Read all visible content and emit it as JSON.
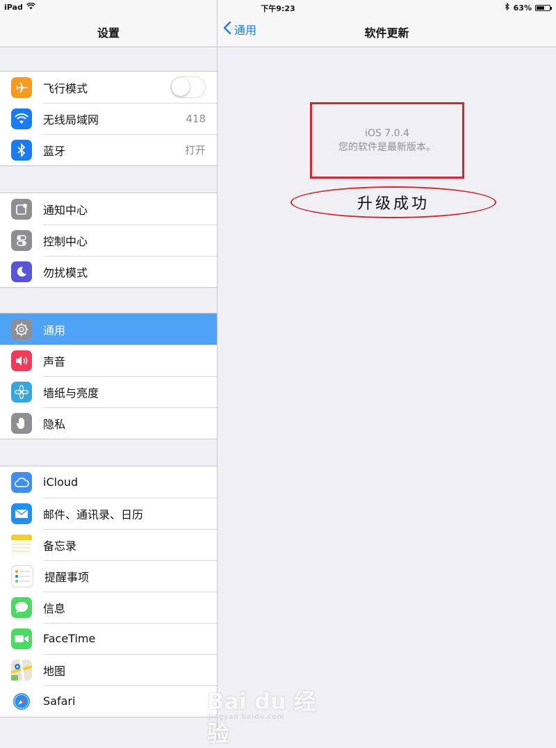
{
  "status_bar": {
    "device": "iPad",
    "time": "下午9:23",
    "battery": "63%",
    "battery_level": 0.63
  },
  "master": {
    "title": "设置",
    "groups": [
      {
        "rows": [
          {
            "label": "飞行模式",
            "icon": "airplane-icon",
            "color": "#f79a1d",
            "toggle": false
          },
          {
            "label": "无线局域网",
            "icon": "wifi-icon",
            "color": "#1a7cf5",
            "value": "418"
          },
          {
            "label": "蓝牙",
            "icon": "bluetooth-icon",
            "color": "#1a7cf5",
            "value": "打开"
          }
        ]
      },
      {
        "rows": [
          {
            "label": "通知中心",
            "icon": "notification-center-icon",
            "color": "#8e8e93"
          },
          {
            "label": "控制中心",
            "icon": "control-center-icon",
            "color": "#8e8e93"
          },
          {
            "label": "勿扰模式",
            "icon": "moon-icon",
            "color": "#5856d6"
          }
        ]
      },
      {
        "rows": [
          {
            "label": "通用",
            "icon": "gear-icon",
            "color": "#8e8e93",
            "selected": true
          },
          {
            "label": "声音",
            "icon": "speaker-icon",
            "color": "#f23b5b"
          },
          {
            "label": "墙纸与亮度",
            "icon": "flower-icon",
            "color": "#35a6de"
          },
          {
            "label": "隐私",
            "icon": "hand-icon",
            "color": "#8e8e93"
          }
        ]
      },
      {
        "rows": [
          {
            "label": "iCloud",
            "icon": "cloud-icon",
            "color": "#3e8ff0"
          },
          {
            "label": "邮件、通讯录、日历",
            "icon": "mail-icon",
            "color": "#1f8ff0"
          },
          {
            "label": "备忘录",
            "icon": "notes-icon",
            "color": "#f5cd28"
          },
          {
            "label": "提醒事项",
            "icon": "reminders-icon",
            "color": "#ffffff"
          },
          {
            "label": "信息",
            "icon": "messages-icon",
            "color": "#4cd964"
          },
          {
            "label": "FaceTime",
            "icon": "facetime-icon",
            "color": "#4cd964"
          },
          {
            "label": "地图",
            "icon": "maps-icon",
            "color": "#e9e4d7"
          },
          {
            "label": "Safari",
            "icon": "safari-icon",
            "color": "#ffffff"
          }
        ]
      }
    ]
  },
  "detail": {
    "back_label": "通用",
    "title": "软件更新",
    "ios_version": "iOS 7.0.4",
    "status_message": "您的软件是最新版本。",
    "annotation": "升级成功"
  },
  "watermark": {
    "brand": "Bai du 经验",
    "url": "jingyan.baidu.com"
  },
  "colors": {
    "accent": "#1a7cf5",
    "selected_row": "#4fa3f7",
    "annotation_red": "#d9232e"
  }
}
